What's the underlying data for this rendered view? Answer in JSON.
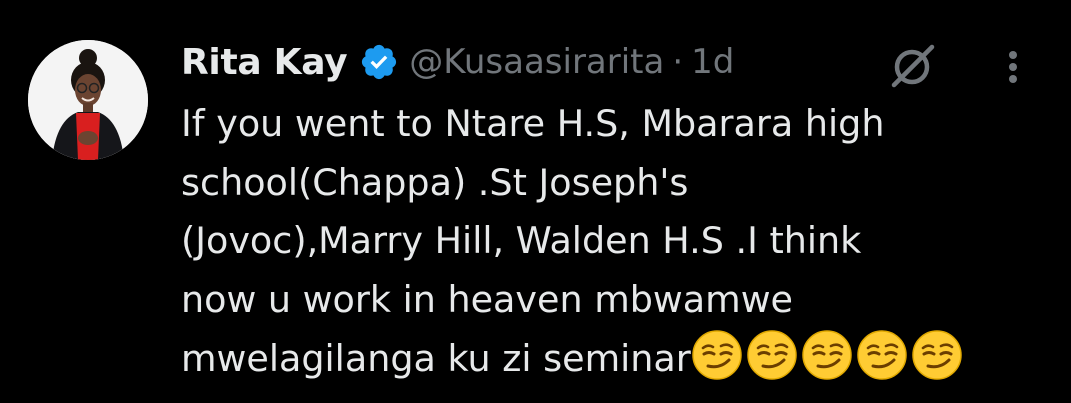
{
  "tweet": {
    "author": {
      "display_name": "Rita Kay",
      "handle": "@Kusaasirarita",
      "verified": true,
      "avatar_icon": "profile-photo"
    },
    "separator": "·",
    "timestamp": "1d",
    "grok_icon": "grok-icon",
    "more_icon": "more-options-icon",
    "text_lines": [
      "If you went to Ntare H.S, Mbarara high",
      "school(Chappa) .St Joseph's",
      "(Jovoc),Marry Hill, Walden H.S .I think",
      "now u work in heaven mbwamwe",
      "mwelagilanga ku zi seminar"
    ],
    "emoji": "😏😏😏😏😏",
    "emoji_name": "smirking-face",
    "emoji_count": 5
  },
  "colors": {
    "background": "#000000",
    "text": "#e7e9ea",
    "muted": "#71767b",
    "verified_blue": "#1d9bf0",
    "emoji_yellow": "#ffcc33"
  }
}
